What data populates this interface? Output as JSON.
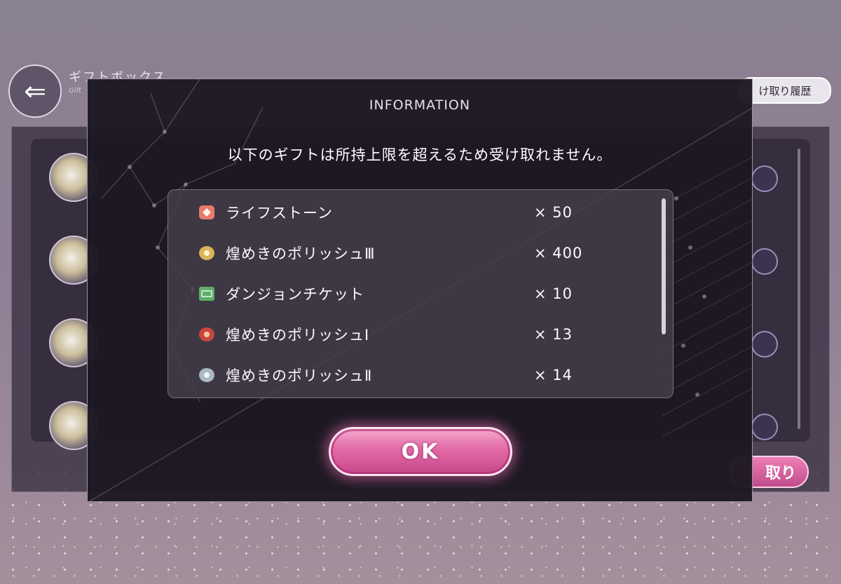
{
  "background": {
    "title": "ギフトボックス",
    "subtitle": "Gift",
    "history_button": "け取り履歴",
    "receive_button": "取り"
  },
  "modal": {
    "title": "INFORMATION",
    "message": "以下のギフトは所持上限を超えるため受け取れません。",
    "items": [
      {
        "name": "ライフストーン",
        "quantity": "× 50",
        "icon": "life-stone-icon",
        "color": "#e8796d"
      },
      {
        "name": "煌めきのポリッシュⅢ",
        "quantity": "× 400",
        "icon": "polish-3-icon",
        "color": "#d9b45a"
      },
      {
        "name": "ダンジョンチケット",
        "quantity": "× 10",
        "icon": "dungeon-ticket-icon",
        "color": "#5fae6a"
      },
      {
        "name": "煌めきのポリッシュⅠ",
        "quantity": "× 13",
        "icon": "polish-1-icon",
        "color": "#c9473e"
      },
      {
        "name": "煌めきのポリッシュⅡ",
        "quantity": "× 14",
        "icon": "polish-2-icon",
        "color": "#a9b8c4"
      }
    ],
    "ok_label": "OK"
  },
  "colors": {
    "accent_pink": "#e26aa6",
    "modal_bg": "#1c1822"
  }
}
